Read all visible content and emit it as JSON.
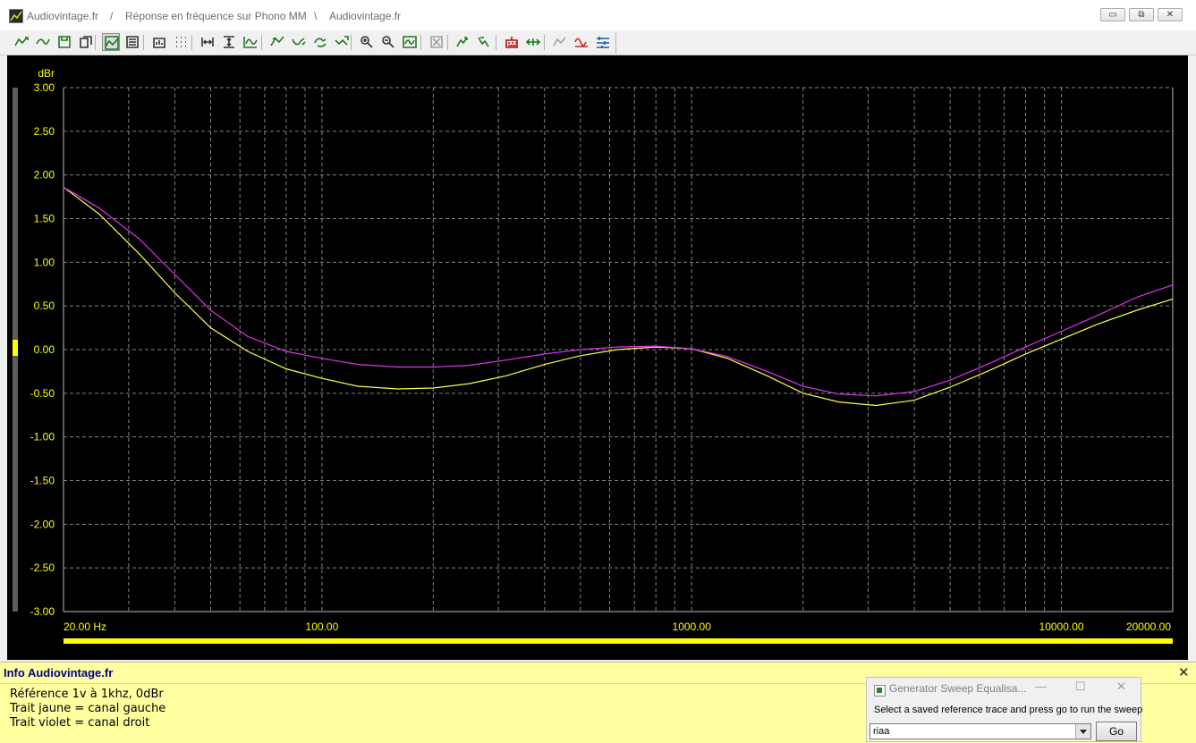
{
  "window": {
    "title_parts": [
      "Audiovintage.fr",
      "/",
      "Réponse en fréquence sur Phono MM",
      "\\",
      "Audiovintage.fr"
    ],
    "controls": {
      "minimize": "▭",
      "restore": "⧉",
      "close": "✕"
    }
  },
  "toolbar": {
    "buttons": [
      {
        "name": "trace-add-icon",
        "color": "#1d7a1d"
      },
      {
        "name": "trace-smooth-icon",
        "color": "#1d7a1d"
      },
      {
        "name": "save-icon",
        "color": "#1d7a1d"
      },
      {
        "name": "copy-icon",
        "color": "#333333"
      },
      {
        "name": "graph-view-icon",
        "color": "#1d7a1d",
        "pressed": true
      },
      {
        "name": "graph-settings-icon",
        "color": "#333333"
      },
      {
        "name": "chart-edit-icon",
        "color": "#333333"
      },
      {
        "name": "grid-dots-icon",
        "color": "#333333"
      },
      {
        "name": "zoom-x-icon",
        "color": "#333333"
      },
      {
        "name": "zoom-y-icon",
        "color": "#333333"
      },
      {
        "name": "wave-icon",
        "color": "#1d7a1d"
      },
      {
        "name": "trace-up-icon",
        "color": "#1d7a1d"
      },
      {
        "name": "trace-down-icon",
        "color": "#1d7a1d"
      },
      {
        "name": "trace-loop-icon",
        "color": "#1d7a1d"
      },
      {
        "name": "trace-check-icon",
        "color": "#1d7a1d"
      },
      {
        "name": "zoom-in-icon",
        "color": "#333333"
      },
      {
        "name": "zoom-out-icon",
        "color": "#333333"
      },
      {
        "name": "wave-box-icon",
        "color": "#1d7a1d"
      },
      {
        "name": "disabled-tool-icon",
        "color": "#a0a0a0"
      },
      {
        "name": "marker-up-icon",
        "color": "#1d7a1d"
      },
      {
        "name": "marker-down-icon",
        "color": "#1d7a1d"
      },
      {
        "name": "generator-icon",
        "color": "#cc0000"
      },
      {
        "name": "arrows-icon",
        "color": "#1d7a1d"
      },
      {
        "name": "disabled-wave-icon",
        "color": "#a0a0a0"
      },
      {
        "name": "sine-icon",
        "color": "#cc2222"
      },
      {
        "name": "eq-icon",
        "color": "#1d5a9a"
      }
    ]
  },
  "chart_data": {
    "type": "line",
    "xscale": "log",
    "xlim": [
      20,
      20000
    ],
    "ylim": [
      -3,
      3
    ],
    "ylabel": "dBr",
    "xticks": [
      {
        "value": 20,
        "label": "20.00 Hz"
      },
      {
        "value": 100,
        "label": "100.00"
      },
      {
        "value": 1000,
        "label": "1000.00"
      },
      {
        "value": 10000,
        "label": "10000.00"
      },
      {
        "value": 20000,
        "label": "20000.00"
      }
    ],
    "yticks": [
      {
        "value": 3,
        "label": "3.00"
      },
      {
        "value": 2.5,
        "label": "2.50"
      },
      {
        "value": 2,
        "label": "2.00"
      },
      {
        "value": 1.5,
        "label": "1.50"
      },
      {
        "value": 1,
        "label": "1.00"
      },
      {
        "value": 0.5,
        "label": "0.50"
      },
      {
        "value": 0,
        "label": "0.00"
      },
      {
        "value": -0.5,
        "label": "-0.50"
      },
      {
        "value": -1,
        "label": "-1.00"
      },
      {
        "value": -1.5,
        "label": "-1.50"
      },
      {
        "value": -2,
        "label": "-2.00"
      },
      {
        "value": -2.5,
        "label": "-2.50"
      },
      {
        "value": -3,
        "label": "-3.00"
      }
    ],
    "grid": true,
    "background": "#000000",
    "axis_text_color": "#ffff00",
    "grid_color": "#9a9a9a",
    "series": [
      {
        "color": "#ffff44",
        "x": [
          20,
          25,
          32,
          40,
          50,
          63,
          80,
          100,
          125,
          160,
          200,
          250,
          315,
          400,
          500,
          630,
          800,
          1000,
          1250,
          1600,
          2000,
          2500,
          3150,
          4000,
          5000,
          6300,
          8000,
          10000,
          12500,
          16000,
          20000
        ],
        "y": [
          1.86,
          1.55,
          1.1,
          0.65,
          0.25,
          -0.02,
          -0.22,
          -0.33,
          -0.42,
          -0.45,
          -0.44,
          -0.39,
          -0.3,
          -0.17,
          -0.07,
          0.0,
          0.03,
          0.01,
          -0.1,
          -0.3,
          -0.5,
          -0.6,
          -0.64,
          -0.58,
          -0.43,
          -0.25,
          -0.05,
          0.12,
          0.29,
          0.45,
          0.58
        ]
      },
      {
        "color": "#dd33ee",
        "x": [
          20,
          25,
          32,
          40,
          50,
          63,
          80,
          100,
          125,
          160,
          200,
          250,
          315,
          400,
          500,
          630,
          800,
          1000,
          1250,
          1600,
          2000,
          2500,
          3150,
          4000,
          5000,
          6300,
          8000,
          10000,
          12500,
          16000,
          20000
        ],
        "y": [
          1.86,
          1.62,
          1.27,
          0.86,
          0.45,
          0.15,
          -0.02,
          -0.1,
          -0.17,
          -0.2,
          -0.2,
          -0.18,
          -0.12,
          -0.05,
          0.0,
          0.03,
          0.04,
          0.01,
          -0.08,
          -0.25,
          -0.42,
          -0.51,
          -0.53,
          -0.48,
          -0.35,
          -0.17,
          0.03,
          0.21,
          0.39,
          0.6,
          0.74
        ]
      }
    ]
  },
  "info": {
    "title": "Info Audiovintage.fr",
    "close": "✕",
    "lines": [
      "Référence 1v à 1khz, 0dBr",
      "Trait jaune = canal gauche",
      "Trait violet = canal droit"
    ]
  },
  "dialog": {
    "title": "Generator Sweep Equalisa...",
    "minimize": "—",
    "maximize": "☐",
    "close": "✕",
    "instruction": "Select a saved reference trace and press go to run the sweep",
    "select_value": "riaa",
    "go_label": "Go"
  }
}
